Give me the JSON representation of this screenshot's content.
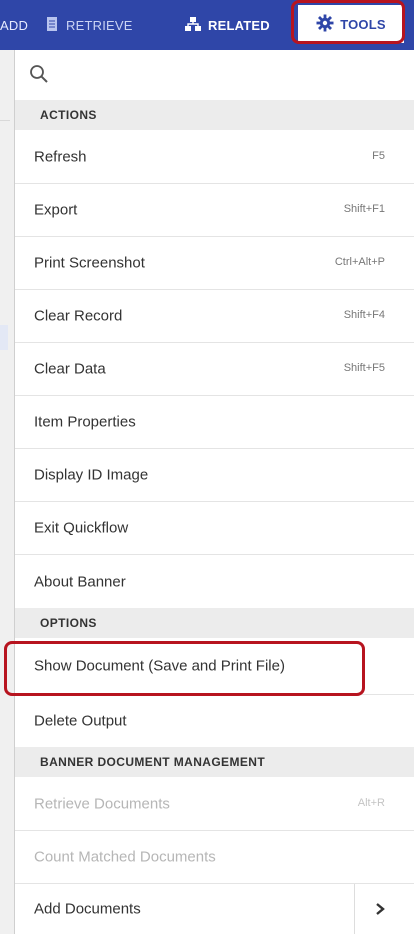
{
  "topnav": {
    "add": "ADD",
    "retrieve": "RETRIEVE",
    "related": "RELATED",
    "tools": "TOOLS"
  },
  "sections": {
    "actions": "ACTIONS",
    "options": "OPTIONS",
    "bdm": "BANNER DOCUMENT MANAGEMENT"
  },
  "actions": [
    {
      "label": "Refresh",
      "shortcut": "F5"
    },
    {
      "label": "Export",
      "shortcut": "Shift+F1"
    },
    {
      "label": "Print Screenshot",
      "shortcut": "Ctrl+Alt+P"
    },
    {
      "label": "Clear Record",
      "shortcut": "Shift+F4"
    },
    {
      "label": "Clear Data",
      "shortcut": "Shift+F5"
    },
    {
      "label": "Item Properties"
    },
    {
      "label": "Display ID Image"
    },
    {
      "label": "Exit Quickflow"
    },
    {
      "label": "About Banner"
    }
  ],
  "options": [
    {
      "label": "Show Document (Save and Print File)"
    },
    {
      "label": "Delete Output"
    }
  ],
  "bdm": [
    {
      "label": "Retrieve Documents",
      "shortcut": "Alt+R",
      "enabled": false
    },
    {
      "label": "Count Matched Documents",
      "enabled": false
    },
    {
      "label": "Add Documents",
      "enabled": true
    }
  ],
  "colors": {
    "nav_bg": "#2f46a8",
    "highlight": "#b7141f"
  }
}
